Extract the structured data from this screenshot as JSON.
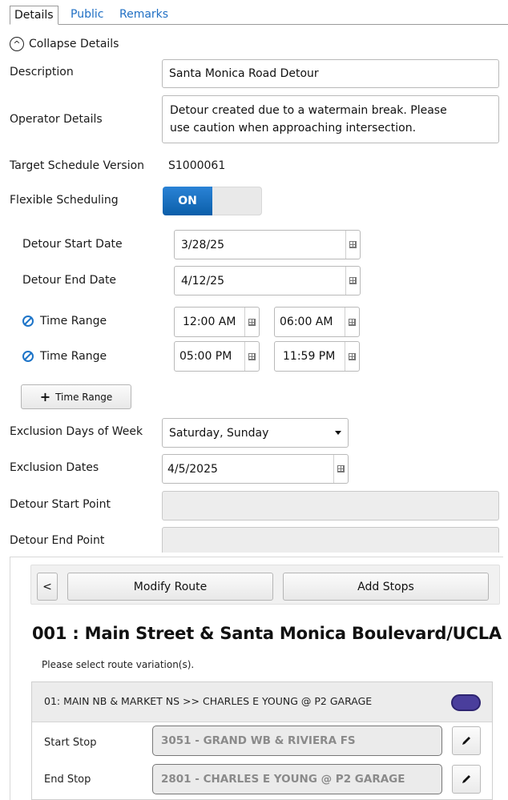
{
  "tabs": [
    "Details",
    "Public",
    "Remarks"
  ],
  "collapse_label": "Collapse Details",
  "form": {
    "description_label": "Description",
    "description_value": "Santa Monica Road Detour",
    "operator_label": "Operator Details",
    "operator_line1": "Detour created due to a watermain break. Please",
    "operator_line2": "use caution when approaching intersection.",
    "schedule_version_label": "Target Schedule Version",
    "schedule_version_value": "S1000061",
    "flexible_label": "Flexible Scheduling",
    "flexible_state": "ON",
    "start_date_label": "Detour Start Date",
    "start_date_value": "3/28/25",
    "end_date_label": "Detour End Date",
    "end_date_value": "4/12/25",
    "time_ranges": [
      {
        "label": "Time Range",
        "from": "12:00 AM",
        "to": "06:00 AM"
      },
      {
        "label": "Time Range",
        "from": "05:00 PM",
        "to": "11:59 PM"
      }
    ],
    "add_time_range_label": "Time Range",
    "exclusion_days_label": "Exclusion Days of Week",
    "exclusion_days_value": "Saturday, Sunday",
    "exclusion_dates_label": "Exclusion Dates",
    "exclusion_dates_value": "4/5/2025",
    "start_point_label": "Detour Start Point",
    "end_point_label": "Detour End Point"
  },
  "route": {
    "back_label": "<",
    "modify_label": "Modify Route",
    "add_stops_label": "Add Stops",
    "title": "001 : Main Street & Santa Monica Boulevard/UCLA",
    "hint": "Please select route variation(s).",
    "variation_label": "01: MAIN NB & MARKET NS >> CHARLES E YOUNG @ P2 GARAGE",
    "variation_color": "#4a3e9c",
    "start_stop_label": "Start Stop",
    "start_stop_value": "3051 - GRAND WB & RIVIERA FS",
    "end_stop_label": "End Stop",
    "end_stop_value": "2801 - CHARLES E YOUNG @ P2 GARAGE"
  },
  "colors": {
    "accent": "#1f6fc4",
    "toggle_on": "#0b5ea9"
  }
}
